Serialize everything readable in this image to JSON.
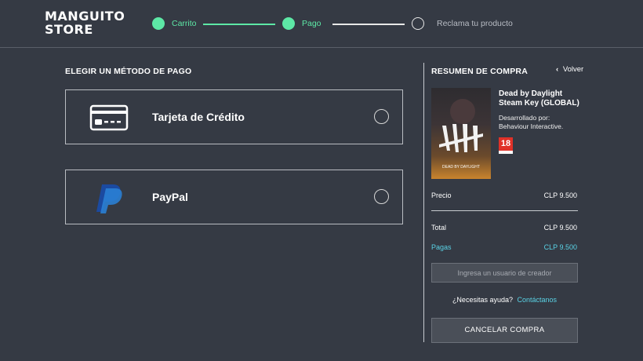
{
  "header": {
    "logo_line1": "MANGUITO",
    "logo_line2": "STORE",
    "steps": [
      {
        "label": "Carrito",
        "active": true
      },
      {
        "label": "Pago",
        "active": true
      },
      {
        "label": "Reclama tu producto",
        "active": false
      }
    ]
  },
  "payment": {
    "title": "ELEGIR UN MÉTODO DE PAGO",
    "options": [
      {
        "label": "Tarjeta de Crédito",
        "icon": "credit-card-icon"
      },
      {
        "label": "PayPal",
        "icon": "paypal-icon"
      }
    ]
  },
  "summary": {
    "title": "RESUMEN DE COMPRA",
    "back_label": "Volver",
    "game": {
      "title": "Dead by Daylight Steam Key (GLOBAL)",
      "dev_label": "Desarrollado por:",
      "developer": "Behaviour Interactive.",
      "cover_text": "DEAD BY DAYLIGHT",
      "rating": "18"
    },
    "price_label": "Precio",
    "price_value": "CLP 9.500",
    "total_label": "Total",
    "total_value": "CLP 9.500",
    "pay_label": "Pagas",
    "pay_value": "CLP 9.500",
    "creator_placeholder": "Ingresa un usuario de creador",
    "help_text": "¿Necesitas ayuda?",
    "help_link": "Contáctanos",
    "cancel_label": "CANCELAR COMPRA"
  },
  "colors": {
    "background": "#353a44",
    "accent_green": "#5de8a6",
    "accent_teal": "#5ad3e6",
    "border": "#b9bcc2"
  }
}
